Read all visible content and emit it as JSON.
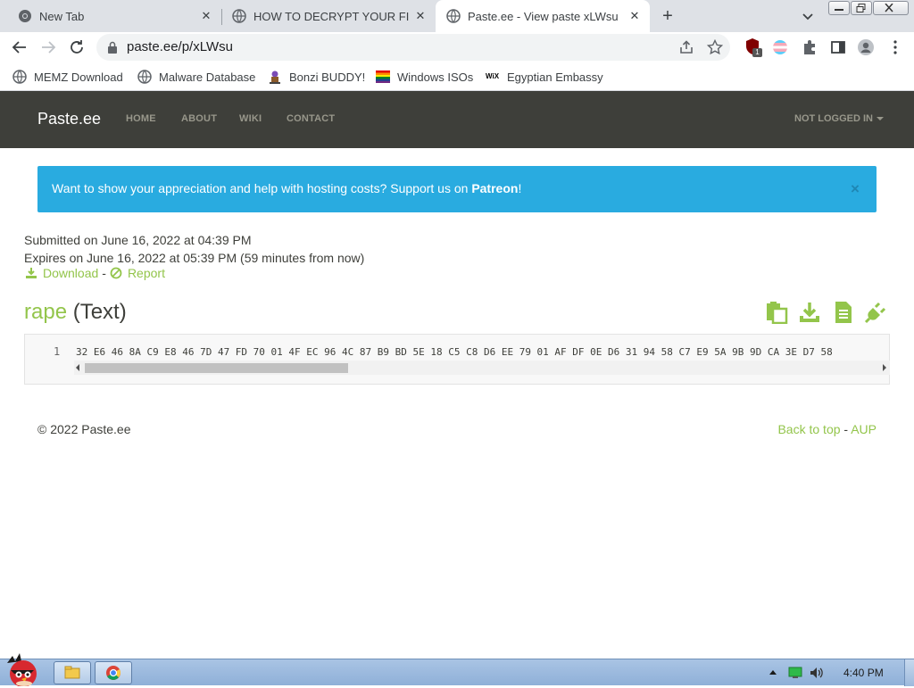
{
  "browser": {
    "tabs": [
      {
        "title": "New Tab",
        "active": false
      },
      {
        "title": "HOW TO DECRYPT YOUR FILE",
        "active": false
      },
      {
        "title": "Paste.ee - View paste xLWsu",
        "active": true
      }
    ],
    "url": "paste.ee/p/xLWsu",
    "extension_badge": "1",
    "bookmarks": [
      {
        "label": "MEMZ Download",
        "icon": "globe-icon"
      },
      {
        "label": "Malware Database",
        "icon": "globe-icon"
      },
      {
        "label": "Bonzi BUDDY!",
        "icon": "bonzi-icon"
      },
      {
        "label": "Windows ISOs",
        "icon": "rainbow-flag-icon"
      },
      {
        "label": "Egyptian Embassy",
        "icon": "wix-icon"
      }
    ],
    "wix_icon_text": "WiX"
  },
  "site": {
    "brand": "Paste.ee",
    "nav": {
      "home": "HOME",
      "about": "ABOUT",
      "wiki": "WIKI",
      "contact": "CONTACT"
    },
    "user_menu": "NOT LOGGED IN",
    "colors": {
      "navbar": "#3e3f3a",
      "alert": "#29abe0",
      "accent": "#93c54b"
    }
  },
  "alert": {
    "text": "Want to show your appreciation and help with hosting costs? Support us on ",
    "link": "Patreon",
    "suffix": "!",
    "close": "×"
  },
  "paste": {
    "submitted": "Submitted on June 16, 2022 at 04:39 PM",
    "expires": "Expires on June 16, 2022 at 05:39 PM (59 minutes from now)",
    "download": "Download",
    "separator": "-",
    "report": "Report",
    "name": "rape",
    "format": "(Text)",
    "line_number": "1",
    "content": "32 E6 46 8A C9 E8 46 7D 47 FD 70 01 4F EC 96 4C 87 B9 BD 5E 18 C5 C8 D6 EE 79 01 AF DF 0E D6 31 94 58 C7 E9 5A 9B 9D CA 3E D7 58"
  },
  "footer": {
    "copyright": "© 2022 Paste.ee",
    "back_to_top": "Back to top",
    "separator": "-",
    "aup": "AUP"
  },
  "taskbar": {
    "clock": "4:40 PM"
  }
}
